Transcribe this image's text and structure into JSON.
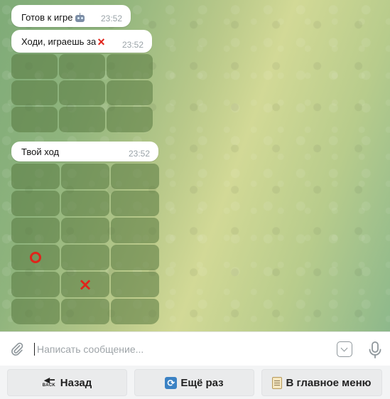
{
  "messages": [
    {
      "text": "Готов к игре",
      "icon": "robot-icon",
      "time": "23:52"
    },
    {
      "text": "Ходи, играешь за",
      "icon": "cross-mark-icon",
      "time": "23:52"
    },
    {
      "text": "Твой ход",
      "time": "23:52"
    }
  ],
  "marks": {
    "x": "×"
  },
  "board_1": {
    "rows": 3,
    "cols": 3,
    "cells": [
      "",
      "",
      "",
      "",
      "",
      "",
      "",
      "",
      ""
    ]
  },
  "board_2": {
    "rows": 6,
    "cols": 3,
    "cells": [
      "",
      "",
      "",
      "",
      "",
      "",
      "",
      "",
      "",
      "O",
      "",
      "",
      "",
      "X",
      "",
      "",
      "",
      ""
    ]
  },
  "input": {
    "placeholder": "Написать сообщение..."
  },
  "keyboard": {
    "back": {
      "label": "Назад",
      "emoji_icon": "back-arrow-icon",
      "emoji_text": "BACK"
    },
    "again": {
      "label": "Ещё раз",
      "emoji_icon": "repeat-icon",
      "emoji_text": "🔄"
    },
    "menu": {
      "label": "В главное меню",
      "emoji_icon": "clipboard-icon"
    }
  },
  "colors": {
    "mark": "#e0241b",
    "cell": "#587840",
    "bubble": "#ffffff"
  }
}
